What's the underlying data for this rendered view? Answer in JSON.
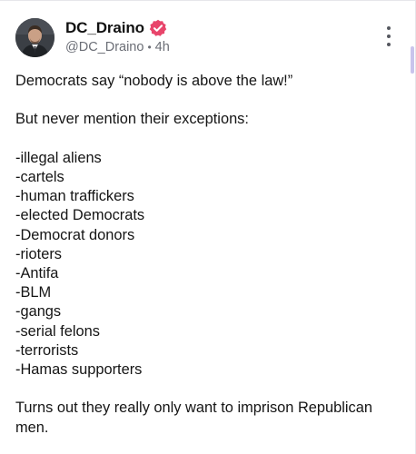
{
  "post": {
    "author": {
      "display_name": "DC_Draino",
      "handle": "@DC_Draino",
      "time_ago": "4h",
      "separator": "•",
      "verified_icon": "verified-badge-icon",
      "verified_color": "#e8456b"
    },
    "intro": "Democrats say “nobody is above the law!”",
    "lead_in": "But never mention their exceptions:",
    "exceptions": [
      "-illegal aliens",
      "-cartels",
      "-human traffickers",
      "-elected Democrats",
      "-Democrat donors",
      "-rioters",
      "-Antifa",
      "-BLM",
      "-gangs",
      "-serial felons",
      "-terrorists",
      "-Hamas supporters"
    ],
    "closing": "Turns out they really only want to imprison Republican men.",
    "menu_icon": "more-vertical-icon"
  }
}
